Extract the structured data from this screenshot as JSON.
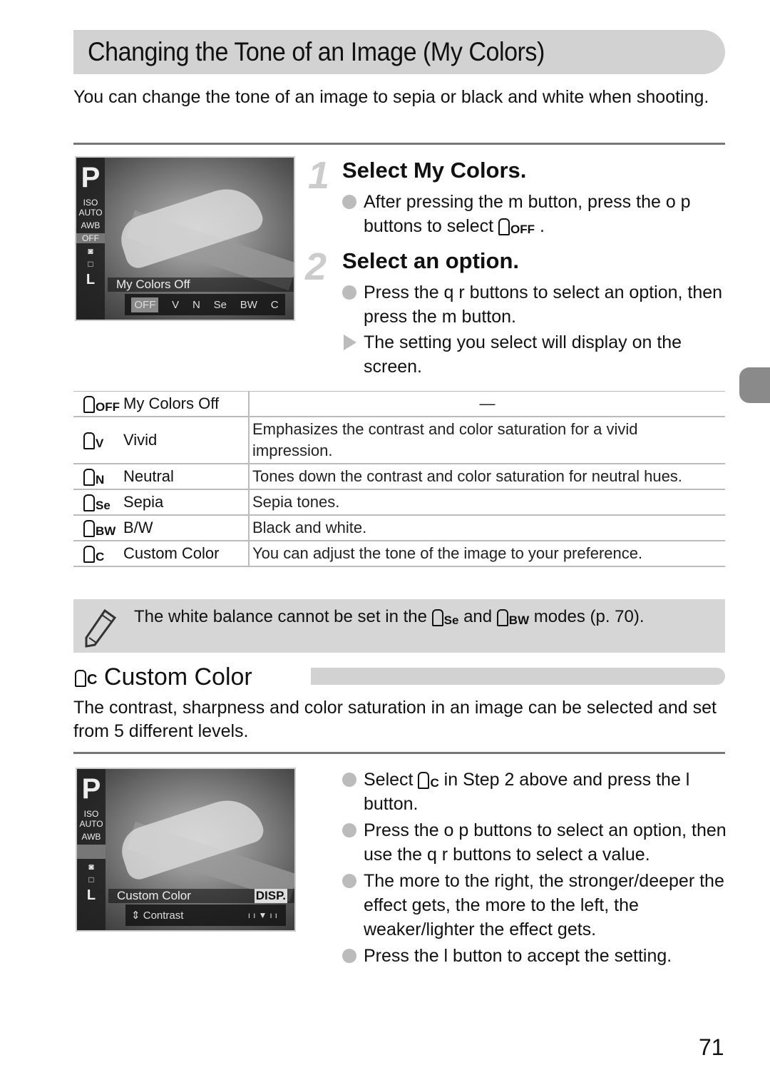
{
  "title": "Changing the Tone of an Image (My Colors)",
  "intro": "You can change the tone of an image to sepia or black and white when shooting.",
  "screen1": {
    "mode": "P",
    "left_icons": [
      "ISO AUTO",
      "AWB",
      "OFF",
      "metering",
      "□",
      "L"
    ],
    "label": "My Colors Off",
    "options": [
      "OFF",
      "V",
      "N",
      "Se",
      "BW",
      "C"
    ]
  },
  "steps": [
    {
      "num": "1",
      "title": "Select My Colors.",
      "bullets": [
        {
          "type": "dot",
          "text": "After pressing the m  button, press the o  p  buttons to select ",
          "icon": "OFF",
          "tail": " ."
        }
      ]
    },
    {
      "num": "2",
      "title": "Select an option.",
      "bullets": [
        {
          "type": "dot",
          "text": "Press the q r  buttons to select an option, then press the m  button."
        },
        {
          "type": "arrow",
          "text": "The setting you select will display on the screen."
        }
      ]
    }
  ],
  "table": [
    {
      "icon": "OFF",
      "name": "My Colors Off",
      "desc": "—"
    },
    {
      "icon": "V",
      "name": "Vivid",
      "desc": "Emphasizes the contrast and color saturation for a vivid impression."
    },
    {
      "icon": "N",
      "name": "Neutral",
      "desc": "Tones down the contrast and color saturation for neutral hues."
    },
    {
      "icon": "Se",
      "name": "Sepia",
      "desc": "Sepia tones."
    },
    {
      "icon": "BW",
      "name": "B/W",
      "desc": "Black and white."
    },
    {
      "icon": "C",
      "name": "Custom Color",
      "desc": "You can adjust the tone of the image to your preference."
    }
  ],
  "note": {
    "a": "The white balance cannot be set in the ",
    "icon1": "Se",
    "b": " and ",
    "icon2": "BW",
    "c": " modes (p. 70)."
  },
  "custom": {
    "icon": "C",
    "heading": "Custom Color",
    "intro": "The contrast, sharpness and color saturation in an image can be selected and set from 5 different levels."
  },
  "screen2": {
    "mode": "P",
    "label": "Custom Color",
    "disp": "DISP.",
    "param": "Contrast",
    "level": 3
  },
  "custom_bullets": [
    {
      "pre": "Select ",
      "icon": "C",
      "post": " in Step 2 above and press the l         button."
    },
    {
      "text": "Press the o  p  buttons to select an option, then use the q r  buttons to select a value."
    },
    {
      "text": "The more to the right, the stronger/deeper the effect gets, the more to the left, the weaker/lighter the effect gets."
    },
    {
      "text": "Press the l          button to accept the setting."
    }
  ],
  "page_number": "71"
}
